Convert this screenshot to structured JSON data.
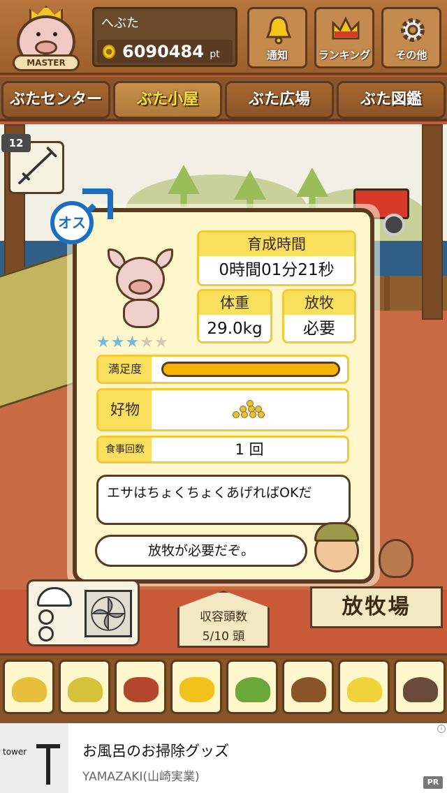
{
  "header": {
    "avatar_badge": "MASTER",
    "player_name": "へぶた",
    "points_value": "6090484",
    "points_unit": "pt",
    "buttons": [
      {
        "label": "通知",
        "icon": "bell-icon"
      },
      {
        "label": "ランキング",
        "icon": "crown-icon"
      },
      {
        "label": "その他",
        "icon": "gear-icon"
      }
    ]
  },
  "tabs": [
    "ぶたセンター",
    "ぶた小屋",
    "ぶた広場",
    "ぶた図鑑"
  ],
  "active_tab": "ぶた小屋",
  "syringe": {
    "count": "12",
    "icon": "syringe-icon"
  },
  "pig": {
    "gender": "オス",
    "gender_icon": "male-symbol-icon",
    "stars_filled": 3,
    "stars_total": 5,
    "rearing_time_label": "育成時間",
    "rearing_time_value": "0時間01分21秒",
    "weight_label": "体重",
    "weight_value": "29.0kg",
    "grazing_label": "放牧",
    "grazing_value": "必要",
    "satisfaction_label": "満足度",
    "satisfaction_level": 1.0,
    "favorite_label": "好物",
    "favorite_icon": "soybean-pile-icon",
    "meal_count_label": "食事回数",
    "meal_count_value": "1 回"
  },
  "dialogue": {
    "line1": "エサはちょくちょくあげればOKだ",
    "line2": "放牧が必要だぞ。"
  },
  "capacity": {
    "label": "収容頭数",
    "value": "5/10 頭"
  },
  "pasture_button": "放牧場",
  "feeds": [
    {
      "icon": "soybean-pile-icon",
      "color": "#e7bf3a"
    },
    {
      "icon": "mixed-grain-pile-icon",
      "color": "#d6c23a"
    },
    {
      "icon": "sweet-potato-icon",
      "color": "#b5462e"
    },
    {
      "icon": "corn-icon",
      "color": "#f2c21a"
    },
    {
      "icon": "vegetable-beans-icon",
      "color": "#6aa83a"
    },
    {
      "icon": "acorn-chestnut-icon",
      "color": "#8a5428"
    },
    {
      "icon": "corn-plate-icon",
      "color": "#f0d23a"
    },
    {
      "icon": "meatball-plate-icon",
      "color": "#6a4a3a"
    }
  ],
  "colors": {
    "panel_bg": "#fdf7cb",
    "label_bg": "#f8df5c",
    "border_brown": "#5a3a20",
    "male_blue": "#1b6fc2",
    "active_tab_text": "#f8e23a",
    "star_on": "#73b8de"
  },
  "ad": {
    "image_brand": "tower",
    "title": "お風呂のお掃除グッズ",
    "advertiser": "YAMAZAKI(山崎実業)",
    "badge": "PR",
    "info_icon": "i"
  }
}
